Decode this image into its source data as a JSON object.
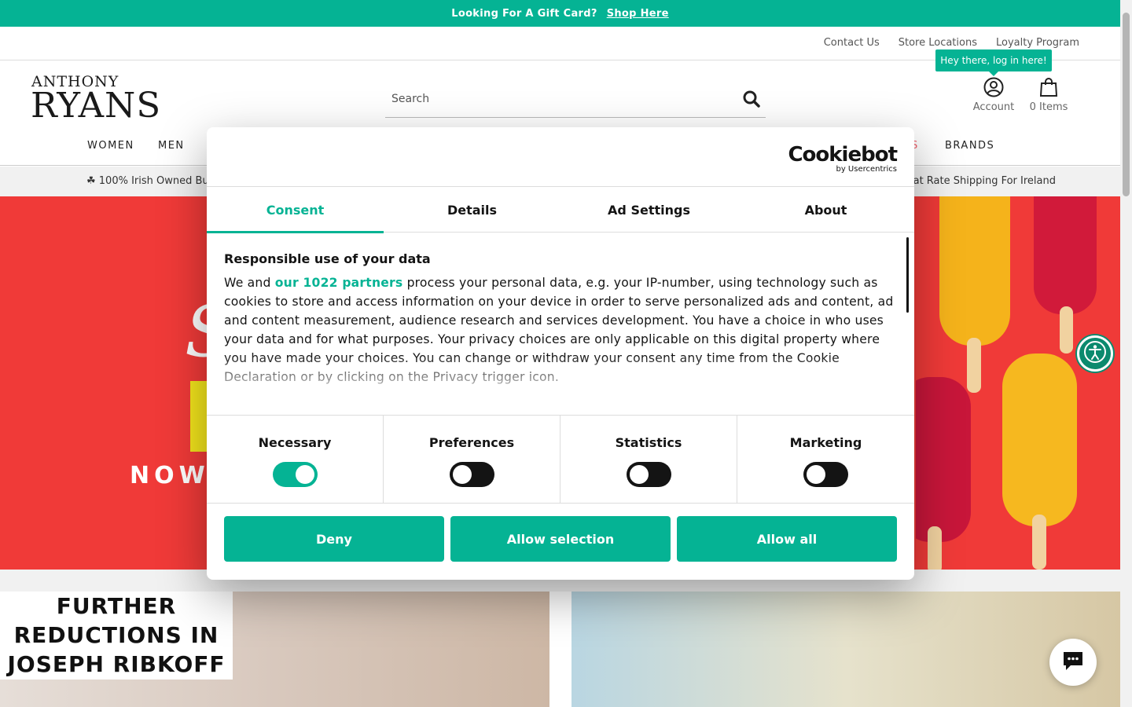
{
  "announcement": {
    "text": "Looking For A Gift Card?",
    "link": "Shop Here"
  },
  "utility_links": [
    "Contact Us",
    "Store Locations",
    "Loyalty Program"
  ],
  "logo": {
    "top": "ANTHONY",
    "bottom": "RYANS"
  },
  "search": {
    "placeholder": "Search"
  },
  "tooltip": "Hey there, log in here!",
  "account": {
    "label": "Account"
  },
  "cart": {
    "label": "0 Items"
  },
  "nav": {
    "women": "WOMEN",
    "men": "MEN",
    "partial_sale": "S",
    "brands": "BRANDS"
  },
  "strip": {
    "left": "☘ 100% Irish Owned Bu",
    "right": "at Rate Shipping For Ireland"
  },
  "hero": {
    "partial_text": "NOW"
  },
  "promo_left": {
    "lines": [
      "FURTHER",
      "REDUCTIONS IN",
      "JOSEPH RIBKOFF"
    ]
  },
  "consent": {
    "brand": "Cookiebot",
    "brand_sub": "by Usercentrics",
    "tabs": [
      "Consent",
      "Details",
      "Ad Settings",
      "About"
    ],
    "heading": "Responsible use of your data",
    "text_before": "We and ",
    "partners": "our 1022 partners",
    "text_after": " process your personal data, e.g. your IP-number, using technology such as cookies to store and access information on your device in order to serve personalized ads and content, ad and content measurement, audience research and services development. You have a choice in who uses your data and for what purposes. Your privacy choices are only applicable on this digital property where you have made your choices. You can change or withdraw your consent any time from the Cookie Declaration or by clicking on the Privacy trigger icon.",
    "toggles": [
      {
        "label": "Necessary",
        "on": true
      },
      {
        "label": "Preferences",
        "on": false
      },
      {
        "label": "Statistics",
        "on": false
      },
      {
        "label": "Marketing",
        "on": false
      }
    ],
    "buttons": {
      "deny": "Deny",
      "allow_selection": "Allow selection",
      "allow_all": "Allow all"
    }
  },
  "colors": {
    "accent": "#05b394",
    "hero_red": "#f03a38",
    "text": "#141414"
  }
}
